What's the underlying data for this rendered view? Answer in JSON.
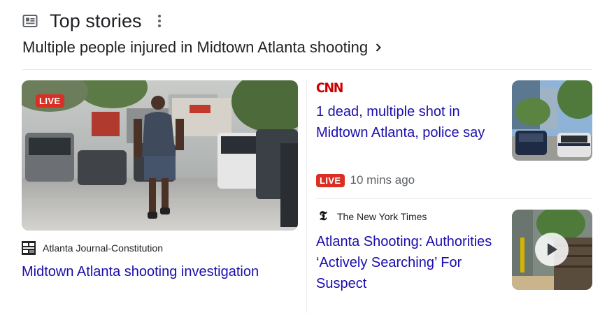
{
  "header": {
    "title": "Top stories",
    "icon": "news-icon",
    "more_icon": "more-vert-icon"
  },
  "topic": {
    "text": "Multiple people injured in Midtown Atlanta shooting",
    "icon": "chevron-right-icon"
  },
  "main_story": {
    "live_label": "LIVE",
    "source": "Atlanta Journal-Constitution",
    "headline": "Midtown Atlanta shooting investigation"
  },
  "side_stories": [
    {
      "source_logo_text": "CNN",
      "headline": "1 dead, multiple shot in Midtown Atlanta, police say",
      "live_label": "LIVE",
      "time": "10 mins ago"
    },
    {
      "source": "The New York Times",
      "source_logo_text": "𝕿",
      "headline": "Atlanta Shooting: Authorities ‘Actively Searching’ For Suspect",
      "has_video": true
    }
  ],
  "colors": {
    "link": "#1a0dab",
    "live": "#d93025",
    "cnn": "#cc0000",
    "text": "#202124",
    "secondary": "#5f6368",
    "divider": "#e8eaed"
  }
}
